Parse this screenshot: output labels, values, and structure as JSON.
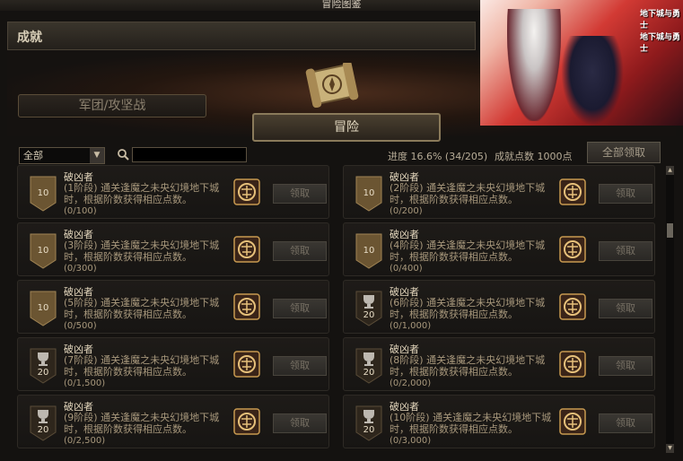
{
  "window_title": "冒险图鉴",
  "section_title": "成就",
  "tabs": [
    {
      "label": "军团/攻坚战",
      "active": false
    },
    {
      "label": "冒险",
      "active": true
    }
  ],
  "filter": {
    "selected": "全部"
  },
  "search": {
    "value": "",
    "placeholder": ""
  },
  "progress_text": "进度  16.6% (34/205)",
  "points_text": "成就点数 1000点",
  "claim_all_label": "全部领取",
  "banner": {
    "logo_text": "地下城与勇士"
  },
  "colors": {
    "accent": "#c8a060",
    "badge_bronze": "#6b5532",
    "badge_dark": "#2e261c"
  },
  "achievements": [
    {
      "name": "破凶者",
      "desc": "(1阶段) 通关逢魔之未央幻境地下城时，根据阶数获得相应点数。",
      "progress": "(0/100)",
      "points": "10",
      "icon": "badge-bronze-icon",
      "claim_label": "领取"
    },
    {
      "name": "破凶者",
      "desc": "(2阶段) 通关逢魔之未央幻境地下城时，根据阶数获得相应点数。",
      "progress": "(0/200)",
      "points": "10",
      "icon": "badge-bronze-icon",
      "claim_label": "领取"
    },
    {
      "name": "破凶者",
      "desc": "(3阶段) 通关逢魔之未央幻境地下城时，根据阶数获得相应点数。",
      "progress": "(0/300)",
      "points": "10",
      "icon": "badge-bronze-icon",
      "claim_label": "领取"
    },
    {
      "name": "破凶者",
      "desc": "(4阶段) 通关逢魔之未央幻境地下城时，根据阶数获得相应点数。",
      "progress": "(0/400)",
      "points": "10",
      "icon": "badge-bronze-icon",
      "claim_label": "领取"
    },
    {
      "name": "破凶者",
      "desc": "(5阶段) 通关逢魔之未央幻境地下城时，根据阶数获得相应点数。",
      "progress": "(0/500)",
      "points": "10",
      "icon": "badge-bronze-icon",
      "claim_label": "领取"
    },
    {
      "name": "破凶者",
      "desc": "(6阶段) 通关逢魔之未央幻境地下城时，根据阶数获得相应点数。",
      "progress": "(0/1,000)",
      "points": "20",
      "icon": "trophy-icon",
      "claim_label": "领取"
    },
    {
      "name": "破凶者",
      "desc": "(7阶段) 通关逢魔之未央幻境地下城时，根据阶数获得相应点数。",
      "progress": "(0/1,500)",
      "points": "20",
      "icon": "trophy-icon",
      "claim_label": "领取"
    },
    {
      "name": "破凶者",
      "desc": "(8阶段) 通关逢魔之未央幻境地下城时，根据阶数获得相应点数。",
      "progress": "(0/2,000)",
      "points": "20",
      "icon": "trophy-icon",
      "claim_label": "领取"
    },
    {
      "name": "破凶者",
      "desc": "(9阶段) 通关逢魔之未央幻境地下城时，根据阶数获得相应点数。",
      "progress": "(0/2,500)",
      "points": "20",
      "icon": "trophy-icon",
      "claim_label": "领取"
    },
    {
      "name": "破凶者",
      "desc": "(10阶段) 通关逢魔之未央幻境地下城时，根据阶数获得相应点数。",
      "progress": "(0/3,000)",
      "points": "20",
      "icon": "trophy-icon",
      "claim_label": "领取"
    }
  ]
}
